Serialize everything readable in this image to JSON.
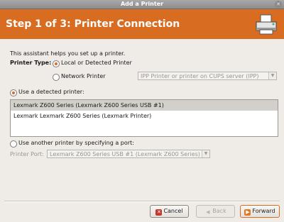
{
  "window": {
    "title": "Add a Printer",
    "close_icon": "close-icon"
  },
  "header": {
    "step_title": "Step 1 of 3: Printer Connection",
    "icon": "printer-icon"
  },
  "intro": "This assistant helps you set up a printer.",
  "printer_type": {
    "label": "Printer Type:",
    "local": "Local or Detected Printer",
    "network": "Network Printer",
    "network_combo_placeholder": "IPP Printer or printer on CUPS server (IPP)",
    "selected": "local"
  },
  "detected": {
    "radio_label": "Use a detected printer:",
    "printers": [
      "Lexmark  Z600 Series (Lexmark  Z600 Series USB #1)",
      "Lexmark  Lexmark  Z600 Series (Lexmark Printer)"
    ],
    "selected_index": 0
  },
  "port": {
    "radio_label": "Use another printer by specifying a port:",
    "field_label": "Printer Port:",
    "combo_value": "Lexmark  Z600 Series USB #1 (Lexmark  Z600 Series)"
  },
  "buttons": {
    "cancel": "Cancel",
    "back": "Back",
    "forward": "Forward"
  },
  "colors": {
    "accent": "#d86d22",
    "window_bg": "#efebe7"
  }
}
